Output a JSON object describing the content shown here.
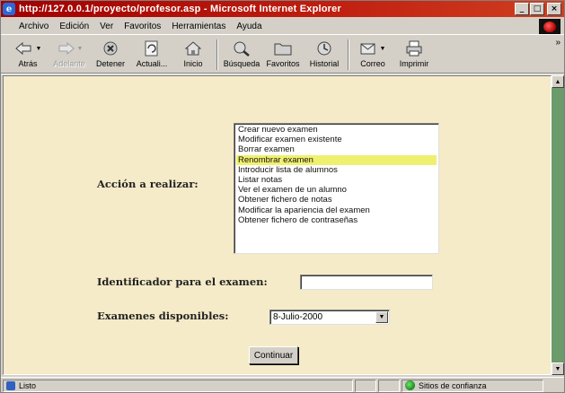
{
  "window": {
    "title": "http://127.0.0.1/proyecto/profesor.asp - Microsoft Internet Explorer",
    "buttons": {
      "minimize": "_",
      "maximize": "□",
      "close": "×"
    }
  },
  "menu": [
    "Archivo",
    "Edición",
    "Ver",
    "Favoritos",
    "Herramientas",
    "Ayuda"
  ],
  "toolbar": {
    "back": "Atrás",
    "forward": "Adelante",
    "stop": "Detener",
    "refresh": "Actuali...",
    "home": "Inicio",
    "search": "Búsqueda",
    "favorites": "Favoritos",
    "history": "Historial",
    "mail": "Correo",
    "print": "Imprimir",
    "more": "»"
  },
  "form": {
    "action_label": "Acción a realizar:",
    "actions": [
      "Crear nuevo examen",
      "Modificar examen existente",
      "Borrar examen",
      "Renombrar examen",
      "Introducir lista de alumnos",
      "Listar notas",
      "Ver el examen de un alumno",
      "Obtener fichero de notas",
      "Modificar la apariencia del examen",
      "Obtener fichero de contraseñas"
    ],
    "selected_action": "Renombrar examen",
    "exam_id_label": "Identificador para el examen:",
    "exam_id_value": "",
    "available_label": "Examenes disponibles:",
    "available_selected": "8-Julio-2000",
    "submit_label": "Continuar"
  },
  "status": {
    "text": "Listo",
    "zone": "Sitios de confianza"
  },
  "colors": {
    "page_bg": "#f5ebc8",
    "selection": "#f0f070",
    "titlebar": "#a00000",
    "scroll_track": "#6b9a6b"
  }
}
